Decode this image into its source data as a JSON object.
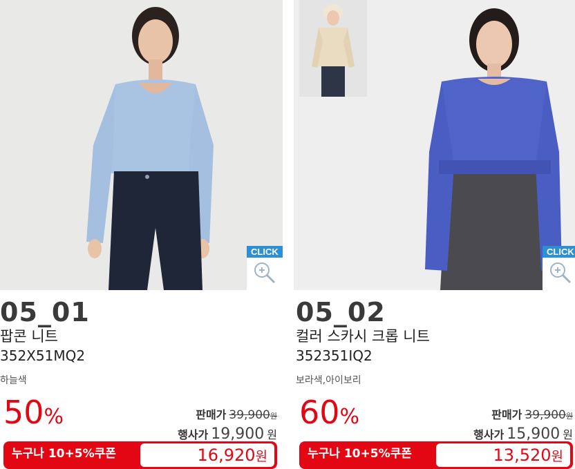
{
  "products": [
    {
      "code": "05_01",
      "name": "팝콘 니트",
      "sku": "352X51MQ2",
      "colors": "하늘색",
      "discount": "50",
      "discount_symbol": "%",
      "original_label": "판매가",
      "original_price": "39,900",
      "original_unit": "원",
      "sale_label": "행사가",
      "sale_price": "19,900",
      "sale_unit": "원",
      "coupon_label": "누구나 10+5%쿠폰",
      "coupon_price": "16,920",
      "coupon_unit": "원",
      "click_label": "CLICK",
      "image": {
        "background": "#e9e9e7",
        "top_color": "#a9c3e3",
        "bottom_color": "#1f2638",
        "skin": "#e8c3a8",
        "hair": "#2b2220"
      }
    },
    {
      "code": "05_02",
      "name": "컬러 스카시 크롭 니트",
      "sku": "352351IQ2",
      "colors": "보라색,아이보리",
      "discount": "60",
      "discount_symbol": "%",
      "original_label": "판매가",
      "original_price": "39,900",
      "original_unit": "원",
      "sale_label": "행사가",
      "sale_price": "15,900",
      "sale_unit": "원",
      "coupon_label": "누구나 10+5%쿠폰",
      "coupon_price": "13,520",
      "coupon_unit": "원",
      "click_label": "CLICK",
      "image": {
        "background": "#eeeeee",
        "top_color": "#4f63c9",
        "skirt_color": "#4a4a4f",
        "skin": "#ecc8b1",
        "hair": "#241c1a",
        "thumb_top": "#eadcc0",
        "thumb_bottom": "#2d3547"
      }
    }
  ],
  "colors": {
    "accent_red": "#e30613",
    "click_blue": "#2d8fd6",
    "text_dark": "#222222"
  }
}
